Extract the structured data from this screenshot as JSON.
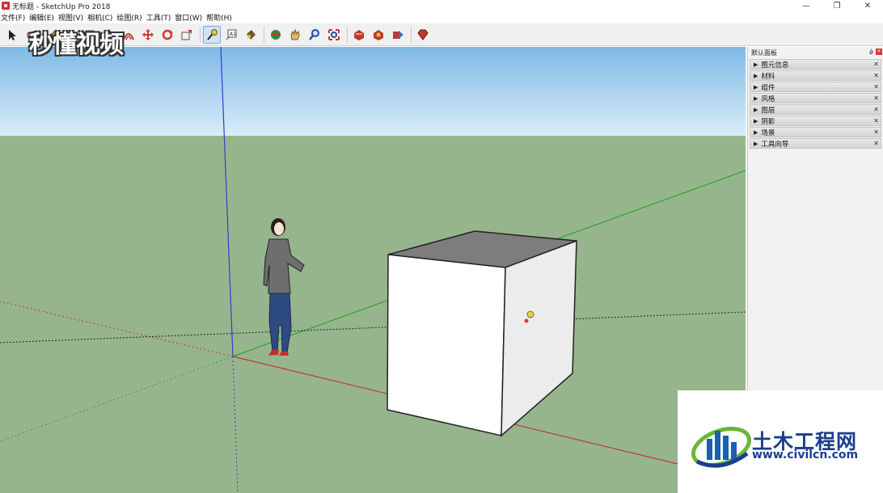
{
  "window": {
    "title": "无标题 - SketchUp Pro 2018",
    "minimize": "—",
    "restore": "❐",
    "close": "✕"
  },
  "menu": [
    "文件(F)",
    "编辑(E)",
    "视图(V)",
    "相机(C)",
    "绘图(R)",
    "工具(T)",
    "窗口(W)",
    "帮助(H)"
  ],
  "toolbar": {
    "tools": [
      {
        "name": "select-tool",
        "icon": "cursor-arrow-icon",
        "color": "#222222"
      },
      {
        "name": "eraser-tool",
        "icon": "eraser-icon",
        "color": "#e07b9b"
      },
      {
        "name": "line-tool",
        "icon": "pencil-icon",
        "color": "#d9a23a"
      },
      {
        "name": "arc-tool",
        "icon": "arc-icon",
        "color": "#c0392b"
      },
      {
        "name": "shape-tool",
        "icon": "rectangle-icon",
        "color": "#8a8a8a"
      },
      {
        "name": "push-pull-tool",
        "icon": "push-pull-icon",
        "color": "#d0382b"
      },
      {
        "name": "offset-tool",
        "icon": "offset-icon",
        "color": "#c0392b"
      },
      {
        "name": "move-tool",
        "icon": "move-icon",
        "color": "#d0382b"
      },
      {
        "name": "rotate-tool",
        "icon": "rotate-icon",
        "color": "#d0382b"
      },
      {
        "name": "scale-tool",
        "icon": "scale-icon",
        "color": "#c0392b"
      },
      {
        "name": "tape-measure-tool",
        "icon": "tape-measure-icon",
        "color": "#e8c33a"
      },
      {
        "name": "text-tool",
        "icon": "text-icon",
        "color": "#555555"
      },
      {
        "name": "paint-bucket-tool",
        "icon": "paint-bucket-icon",
        "color": "#6a5a2a"
      },
      {
        "name": "orbit-tool",
        "icon": "orbit-icon",
        "color": "#2f8a3a"
      },
      {
        "name": "pan-tool",
        "icon": "pan-hand-icon",
        "color": "#e6b866"
      },
      {
        "name": "zoom-tool",
        "icon": "zoom-icon",
        "color": "#1e4fa3"
      },
      {
        "name": "zoom-extents-tool",
        "icon": "zoom-extents-icon",
        "color": "#c0392b"
      },
      {
        "name": "warehouse-tool",
        "icon": "3d-warehouse-icon",
        "color": "#c0392b"
      },
      {
        "name": "extension-warehouse-tool",
        "icon": "extension-warehouse-icon",
        "color": "#c0392b"
      },
      {
        "name": "share-model-tool",
        "icon": "share-model-icon",
        "color": "#3a6fc4"
      },
      {
        "name": "ruby-console-tool",
        "icon": "ruby-icon",
        "color": "#c0392b"
      }
    ]
  },
  "watermark_top": "秒懂视频",
  "panel": {
    "title": "默认面板",
    "pin": "ǿ",
    "trays": [
      "图元信息",
      "材料",
      "组件",
      "风格",
      "图层",
      "阴影",
      "场景",
      "工具向导"
    ]
  },
  "watermark_bottom": {
    "title": "土木工程网",
    "url": "www.civilcn.com"
  },
  "colors": {
    "sky_top": "#7fb9e6",
    "sky_bottom": "#d9ecf8",
    "ground": "#97b58d",
    "axis_red": "#c0392b",
    "axis_green": "#2fa32f",
    "axis_blue": "#2d3fc7",
    "box_top": "#7d7d7d",
    "box_front": "#ffffff",
    "box_side": "#ececec"
  }
}
